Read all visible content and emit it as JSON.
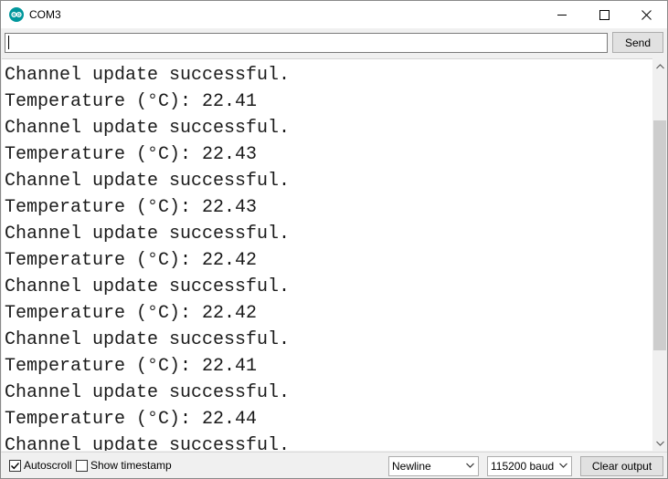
{
  "window": {
    "title": "COM3",
    "brand_color": "#00979c"
  },
  "input": {
    "value": "",
    "send_label": "Send"
  },
  "output": {
    "lines": [
      "Channel update successful.",
      "Temperature (°C): 22.41",
      "Channel update successful.",
      "Temperature (°C): 22.43",
      "Channel update successful.",
      "Temperature (°C): 22.43",
      "Channel update successful.",
      "Temperature (°C): 22.42",
      "Channel update successful.",
      "Temperature (°C): 22.42",
      "Channel update successful.",
      "Temperature (°C): 22.41",
      "Channel update successful.",
      "Temperature (°C): 22.44",
      "Channel update successful."
    ]
  },
  "footer": {
    "autoscroll_label": "Autoscroll",
    "autoscroll_checked": true,
    "timestamp_label": "Show timestamp",
    "timestamp_checked": false,
    "line_ending": "Newline",
    "baud_rate": "115200 baud",
    "clear_label": "Clear output"
  },
  "icons": {
    "app": "arduino-logo-icon",
    "minimize": "minimize-icon",
    "maximize": "maximize-icon",
    "close": "close-icon",
    "scroll_up": "chevron-up-icon",
    "scroll_down": "chevron-down-icon",
    "dropdown": "chevron-down-icon",
    "check": "check-icon"
  }
}
